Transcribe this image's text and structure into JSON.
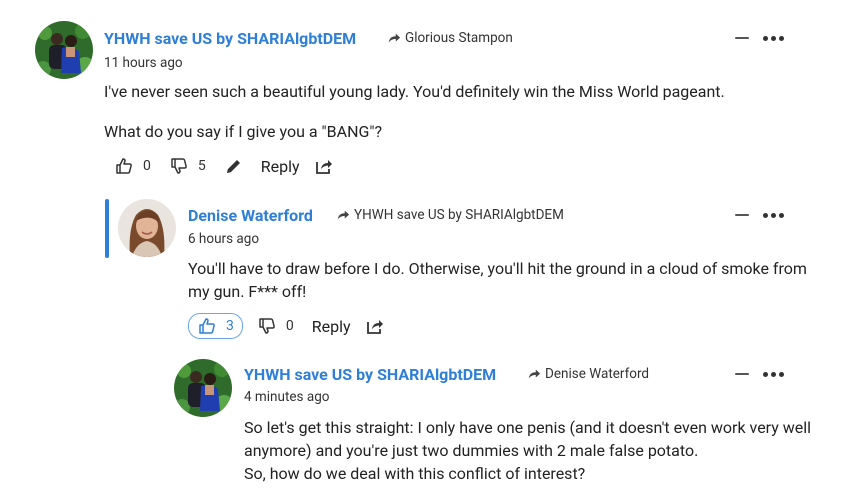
{
  "comments": [
    {
      "author": "YHWH save US by SHARIAlgbtDEM",
      "reply_to": "Glorious Stampon",
      "time": "11 hours ago",
      "paragraphs": [
        "I've never seen such a beautiful young lady. You'd definitely win the Miss World pageant.",
        "What do you say if I give you a \"BANG\"?"
      ],
      "likes": "0",
      "dislikes": "5",
      "reply_label": "Reply",
      "avatar_icon": "avatar-photo-couple"
    },
    {
      "author": "Denise Waterford",
      "reply_to": "YHWH save US by SHARIAlgbtDEM",
      "time": "6 hours ago",
      "paragraphs": [
        "You'll have to draw before I do. Otherwise, you'll hit the ground in a cloud of smoke from my gun. F*** off!"
      ],
      "likes": "3",
      "dislikes": "0",
      "reply_label": "Reply",
      "avatar_icon": "avatar-photo-woman"
    },
    {
      "author": "YHWH save US by SHARIAlgbtDEM",
      "reply_to": "Denise Waterford",
      "time": "4 minutes ago",
      "paragraphs": [
        "So let's get this straight: I only have one penis (and it doesn't even work very well anymore) and you're just two dummies with 2 male false potato.",
        "So, how do we deal with this conflict of interest?"
      ],
      "avatar_icon": "avatar-photo-couple"
    }
  ],
  "colors": {
    "accent": "#2e7fd6",
    "text": "#222222"
  }
}
